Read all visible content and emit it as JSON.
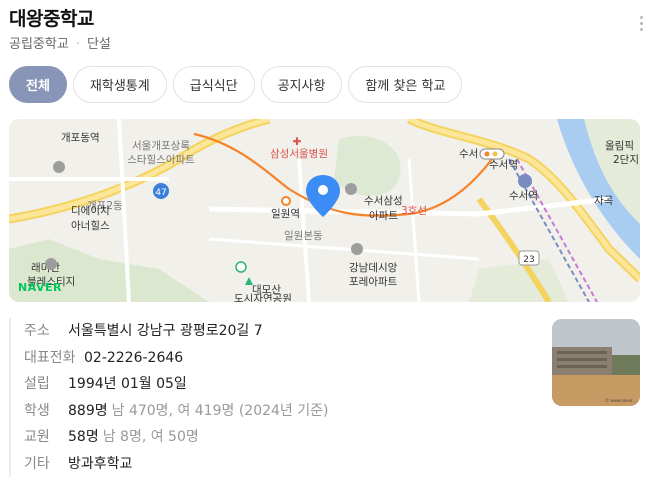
{
  "header": {
    "title": "대왕중학교",
    "type": "공립중학교",
    "gender": "단설"
  },
  "tabs": [
    {
      "label": "전체",
      "active": true
    },
    {
      "label": "재학생통계",
      "active": false
    },
    {
      "label": "급식식단",
      "active": false
    },
    {
      "label": "공지사항",
      "active": false
    },
    {
      "label": "함께 찾은 학교",
      "active": false
    }
  ],
  "map": {
    "provider": "NAVER",
    "labels": {
      "gaepo": "개포동역",
      "apt1_line1": "서울개포상록",
      "apt1_line2": "스타힐스아파트",
      "hospital": "삼성서울병원",
      "suseo": "수서",
      "suseo_station": "수서역",
      "olympic1": "올림픽",
      "olympic2": "2단지",
      "gaepo2": "개포2동",
      "diech1": "디에이치",
      "diech2": "아너힐스",
      "irwon_station": "일원역",
      "samsung_apt1": "수서삼성",
      "samsung_apt2": "아파트",
      "line3": "3호선",
      "irwon_bon": "일원본동",
      "suseo_station2": "수서역",
      "jagok": "자곡",
      "raemian1": "래미안",
      "raemian2": "블레스티지",
      "daemo1": "대모산",
      "daemo2": "도시자연공원",
      "gangnam_apt1": "강남데시앙",
      "gangnam_apt2": "포레아파트",
      "route47": "47",
      "route23": "23"
    }
  },
  "info": {
    "address": {
      "label": "주소",
      "value": "서울특별시 강남구 광평로20길 7"
    },
    "phone": {
      "label": "대표전화",
      "value": "02-2226-2646"
    },
    "founded": {
      "label": "설립",
      "value": "1994년 01월 05일"
    },
    "students": {
      "label": "학생",
      "value": "889명",
      "detail": "남 470명, 여 419명 (2024년 기준)"
    },
    "teachers": {
      "label": "교원",
      "value": "58명",
      "detail": "남 8명, 여 50명"
    },
    "etc": {
      "label": "기타",
      "value": "방과후학교"
    }
  },
  "photo": {
    "watermark": "© www.naver..."
  },
  "colors": {
    "active_tab": "#8995b7",
    "map_pin": "#3b8cf5",
    "naver_green": "#03c75a",
    "subway_line": "#f5832a"
  }
}
